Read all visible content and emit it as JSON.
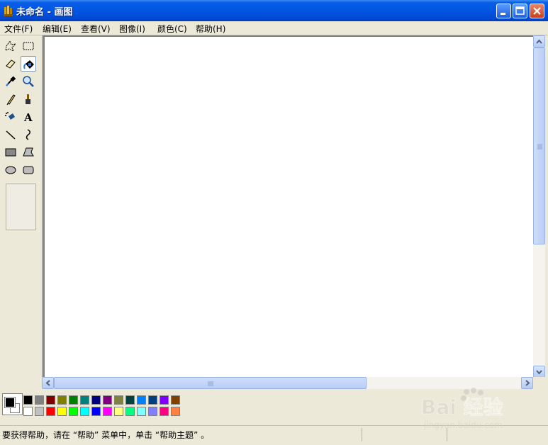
{
  "window": {
    "title": "未命名 - 画图"
  },
  "menu": [
    "文件(F)",
    "编辑(E)",
    "查看(V)",
    "图像(I)",
    "颜色(C)",
    "帮助(H)"
  ],
  "tools": [
    "free-form-select",
    "rect-select",
    "eraser",
    "fill-with-color",
    "pick-color",
    "magnifier",
    "pencil",
    "brush",
    "airbrush",
    "text",
    "line",
    "curve",
    "rectangle",
    "polygon",
    "ellipse",
    "rounded-rectangle"
  ],
  "active_tool": "fill-with-color",
  "colors": {
    "foreground": "#000000",
    "background": "#FFFFFF",
    "palette_top": [
      "#000000",
      "#808080",
      "#800000",
      "#808000",
      "#008000",
      "#008080",
      "#000080",
      "#800080",
      "#808040",
      "#004040",
      "#0080FF",
      "#004080",
      "#8000FF",
      "#804000"
    ],
    "palette_bottom": [
      "#FFFFFF",
      "#C0C0C0",
      "#FF0000",
      "#FFFF00",
      "#00FF00",
      "#00FFFF",
      "#0000FF",
      "#FF00FF",
      "#FFFF80",
      "#00FF80",
      "#80FFFF",
      "#8080FF",
      "#FF0080",
      "#FF8040"
    ]
  },
  "status": {
    "text": "要获得帮助，请在 “帮助” 菜单中，单击 “帮助主题” 。"
  },
  "watermark": {
    "brand": "Bai 经验",
    "url": "jingyan.baidu.com"
  }
}
